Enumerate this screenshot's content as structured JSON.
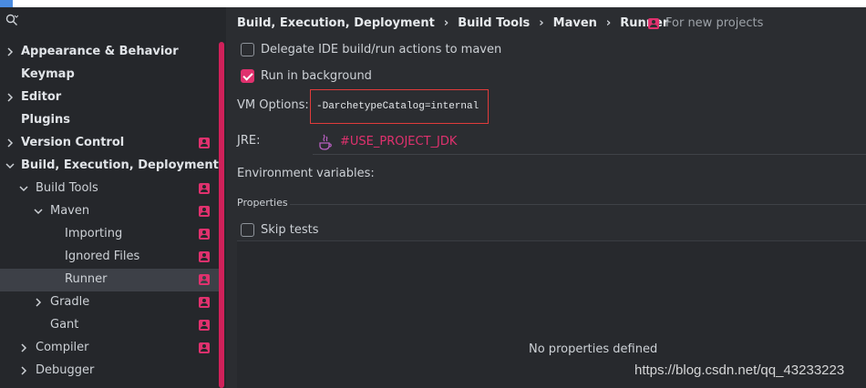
{
  "sidebar": {
    "search": {
      "placeholder": "",
      "value": ""
    },
    "items": [
      {
        "label": "Appearance & Behavior",
        "bold": true,
        "has_badge": false
      },
      {
        "label": "Keymap",
        "bold": true,
        "has_badge": false
      },
      {
        "label": "Editor",
        "bold": true,
        "has_badge": false
      },
      {
        "label": "Plugins",
        "bold": true,
        "has_badge": false
      },
      {
        "label": "Version Control",
        "bold": true,
        "has_badge": true
      },
      {
        "label": "Build, Execution, Deployment",
        "bold": true,
        "has_badge": false
      },
      {
        "label": "Build Tools",
        "bold": false,
        "has_badge": true
      },
      {
        "label": "Maven",
        "bold": false,
        "has_badge": true
      },
      {
        "label": "Importing",
        "bold": false,
        "has_badge": true
      },
      {
        "label": "Ignored Files",
        "bold": false,
        "has_badge": true
      },
      {
        "label": "Runner",
        "bold": false,
        "has_badge": true,
        "selected": true
      },
      {
        "label": "Gradle",
        "bold": false,
        "has_badge": true
      },
      {
        "label": "Gant",
        "bold": false,
        "has_badge": true
      },
      {
        "label": "Compiler",
        "bold": false,
        "has_badge": true
      },
      {
        "label": "Debugger",
        "bold": false,
        "has_badge": false
      }
    ]
  },
  "breadcrumb": {
    "items": [
      "Build, Execution, Deployment",
      "Build Tools",
      "Maven",
      "Runner"
    ],
    "separator": "›",
    "scope_label": "For new projects"
  },
  "options": {
    "delegate_label": "Delegate IDE build/run actions to maven",
    "delegate_checked": false,
    "background_label": "Run in background",
    "background_checked": true
  },
  "vm_options": {
    "label": "VM Options:",
    "value": "-DarchetypeCatalog=internal"
  },
  "jre": {
    "label": "JRE:",
    "value": "#USE_PROJECT_JDK",
    "icon": "java-icon"
  },
  "env": {
    "label": "Environment variables:"
  },
  "properties": {
    "title": "Properties",
    "skip_tests_label": "Skip tests",
    "skip_tests_checked": false,
    "empty_text": "No properties defined"
  },
  "watermark": "https://blog.csdn.net/qq_43233223",
  "colors": {
    "accent": "#e0316e",
    "highlight_border": "#e03b3b",
    "sidebar_bg": "#25272b",
    "main_bg": "#2b2d31"
  }
}
